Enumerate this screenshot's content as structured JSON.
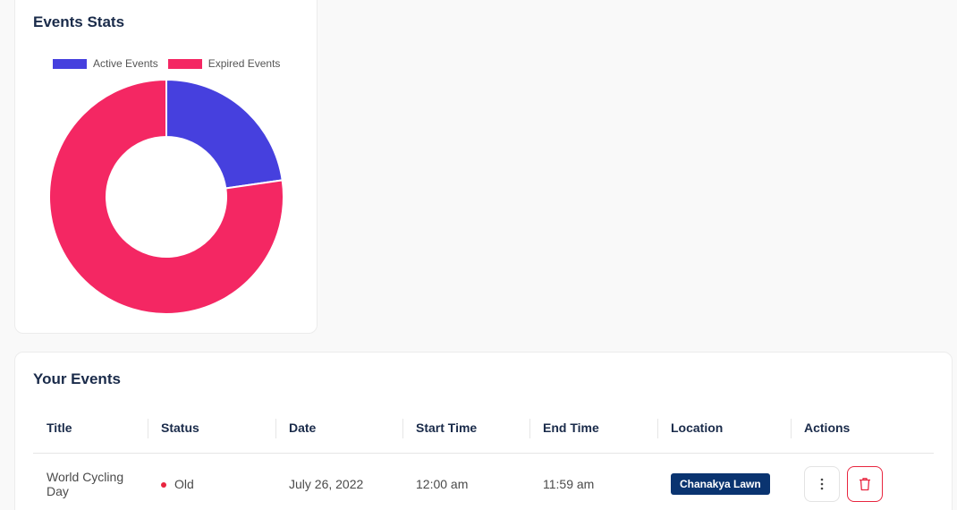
{
  "colors": {
    "active": "#4640de",
    "expired": "#f42763",
    "badge": "#0a3470",
    "status_old": "#e8253f"
  },
  "stats": {
    "title": "Events Stats",
    "legend": [
      {
        "label": "Active Events",
        "color": "#4640de"
      },
      {
        "label": "Expired Events",
        "color": "#f42763"
      }
    ]
  },
  "chart_data": {
    "type": "pie",
    "variant": "doughnut",
    "categories": [
      "Active Events",
      "Expired Events"
    ],
    "values": [
      1,
      3.4
    ],
    "title": "Events Stats",
    "legend_placement": "top"
  },
  "events": {
    "title": "Your Events",
    "columns": [
      "Title",
      "Status",
      "Date",
      "Start Time",
      "End Time",
      "Location",
      "Actions"
    ],
    "rows": [
      {
        "title": "World Cycling Day",
        "status": "Old",
        "date": "July 26, 2022",
        "start_time": "12:00 am",
        "end_time": "11:59 am",
        "location": "Chanakya Lawn",
        "actions": {
          "more_icon": "more-vertical-icon",
          "delete_icon": "trash-icon"
        }
      }
    ]
  }
}
